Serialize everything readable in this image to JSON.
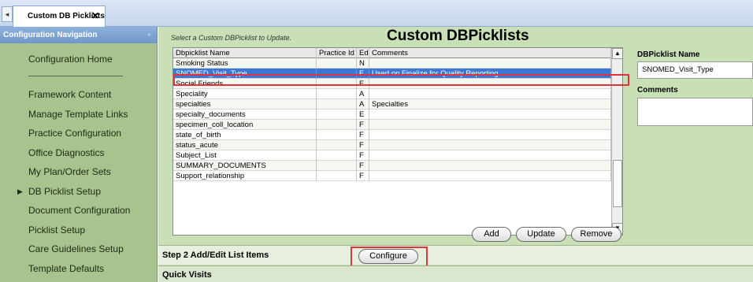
{
  "tabs": {
    "nav_glyph": "◂",
    "active_tab_label": "Custom DB Picklists",
    "close_glyph": "✕"
  },
  "nav": {
    "header": "Configuration Navigation",
    "pin_glyph": "▫",
    "items": [
      {
        "label": "Configuration Home"
      },
      {
        "label": "Framework Content"
      },
      {
        "label": "Manage Template Links"
      },
      {
        "label": "Practice Configuration"
      },
      {
        "label": "Office Diagnostics"
      },
      {
        "label": "My Plan/Order Sets"
      },
      {
        "label": "DB Picklist Setup",
        "arrow": "▶"
      },
      {
        "label": "Document Configuration"
      },
      {
        "label": "Picklist Setup"
      },
      {
        "label": "Care Guidelines Setup"
      },
      {
        "label": "Template Defaults"
      }
    ]
  },
  "main": {
    "instruction": "Select a Custom DBPicklist to Update.",
    "heading": "Custom DBPicklists",
    "columns": [
      "Dbpicklist Name",
      "Practice Id",
      "Edit",
      "Comments"
    ],
    "rows": [
      {
        "name": "Smoking Status",
        "practice": "",
        "edit": "N",
        "comments": ""
      },
      {
        "name": "SNOMED_Visit_Type",
        "practice": "",
        "edit": "F",
        "comments": "Used on Finalize for Quality Reporting",
        "selected": true
      },
      {
        "name": "Social Friends",
        "practice": "",
        "edit": "F",
        "comments": ""
      },
      {
        "name": "Speciality",
        "practice": "",
        "edit": "A",
        "comments": ""
      },
      {
        "name": "specialties",
        "practice": "",
        "edit": "A",
        "comments": "Specialties"
      },
      {
        "name": "specialty_documents",
        "practice": "",
        "edit": "E",
        "comments": ""
      },
      {
        "name": "specimen_coll_location",
        "practice": "",
        "edit": "F",
        "comments": ""
      },
      {
        "name": "state_of_birth",
        "practice": "",
        "edit": "F",
        "comments": ""
      },
      {
        "name": "status_acute",
        "practice": "",
        "edit": "F",
        "comments": ""
      },
      {
        "name": "Subject_List",
        "practice": "",
        "edit": "F",
        "comments": ""
      },
      {
        "name": "SUMMARY_DOCUMENTS",
        "practice": "",
        "edit": "F",
        "comments": ""
      },
      {
        "name": "Support_relationship",
        "practice": "",
        "edit": "F",
        "comments": ""
      }
    ],
    "scroll_up_glyph": "▲",
    "scroll_down_glyph": "▼",
    "buttons": {
      "add": "Add",
      "update": "Update",
      "remove": "Remove"
    },
    "side": {
      "name_label": "DBPicklist Name",
      "name_value": "SNOMED_Visit_Type",
      "comments_label": "Comments",
      "comments_value": ""
    },
    "step2_label": "Step 2 Add/Edit List Items",
    "configure_button": "Configure",
    "quick_visits_label": "Quick Visits"
  },
  "colors": {
    "nav_bg": "#a7c38e",
    "content_bg": "#c9dfb6",
    "selected_row": "#3a78d8",
    "highlight_outline": "#e0343a"
  }
}
